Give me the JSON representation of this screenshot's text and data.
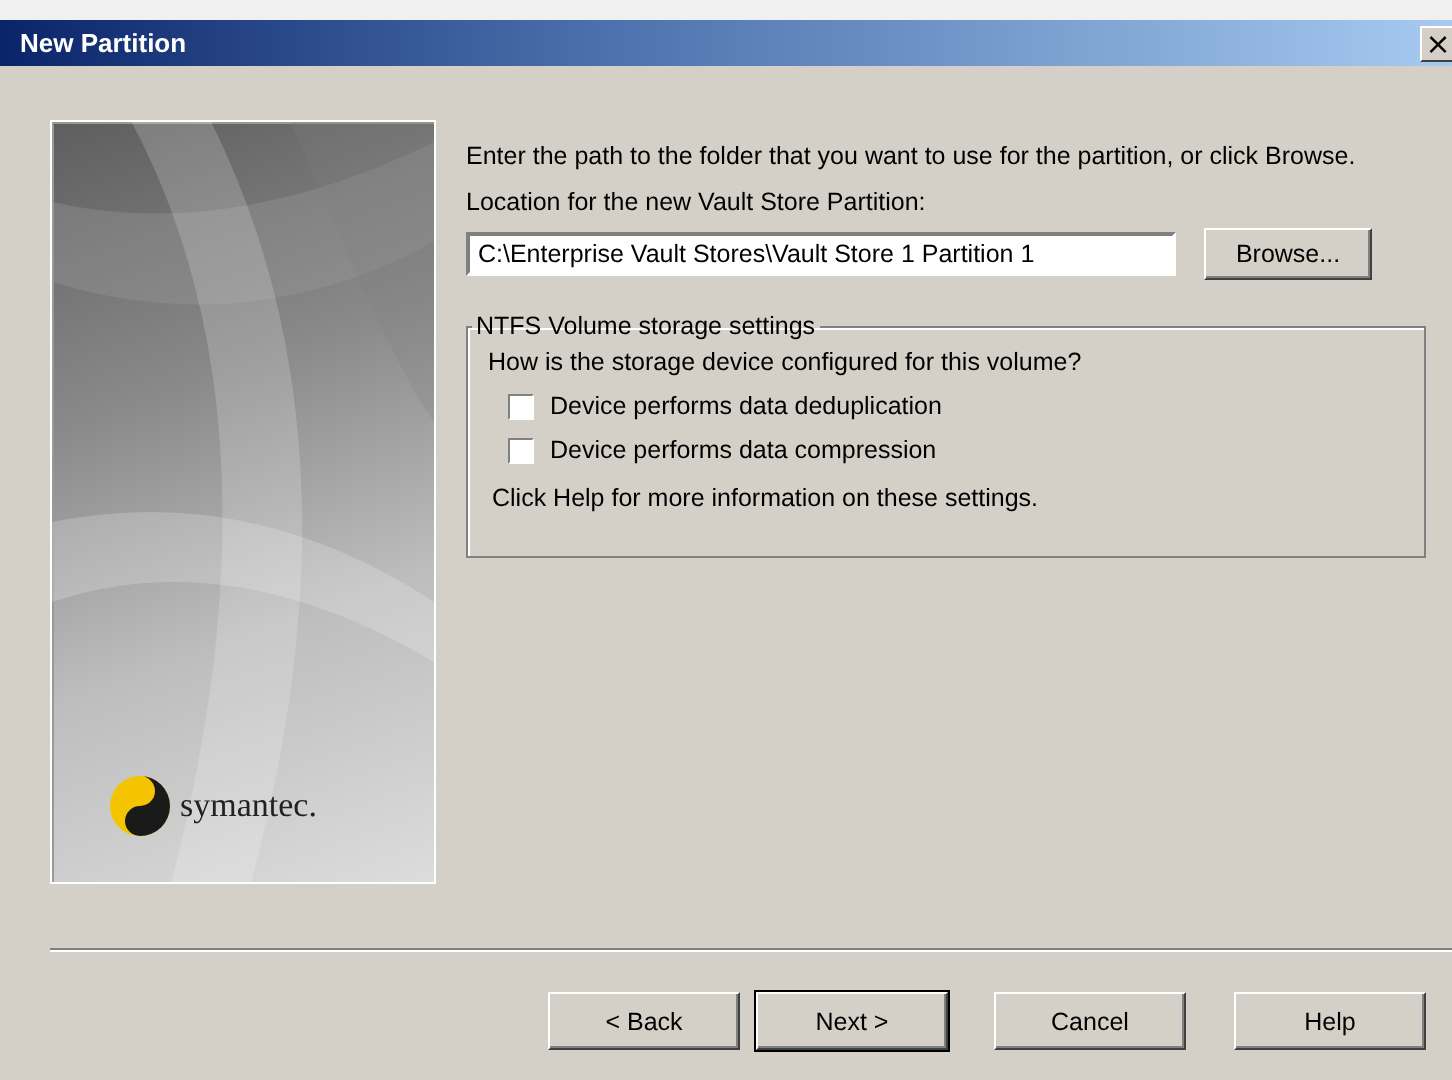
{
  "window": {
    "title": "New Partition",
    "close": "×"
  },
  "logo": {
    "text": "symantec."
  },
  "intro": "Enter the path to the folder that you want to use for the partition, or click Browse.",
  "location": {
    "label": "Location for the new Vault Store Partition:",
    "value": "C:\\Enterprise Vault Stores\\Vault Store 1 Partition 1",
    "browse": "Browse..."
  },
  "group": {
    "title": "NTFS Volume storage settings",
    "question": "How is the storage device configured for this volume?",
    "options": [
      {
        "label": "Device performs data deduplication",
        "checked": false
      },
      {
        "label": "Device performs data compression",
        "checked": false
      }
    ],
    "note": "Click Help for more information on these settings."
  },
  "buttons": [
    {
      "label": "< Back",
      "default": false
    },
    {
      "label": "Next >",
      "default": true
    },
    {
      "label": "Cancel",
      "default": false
    },
    {
      "label": "Help",
      "default": false
    }
  ]
}
